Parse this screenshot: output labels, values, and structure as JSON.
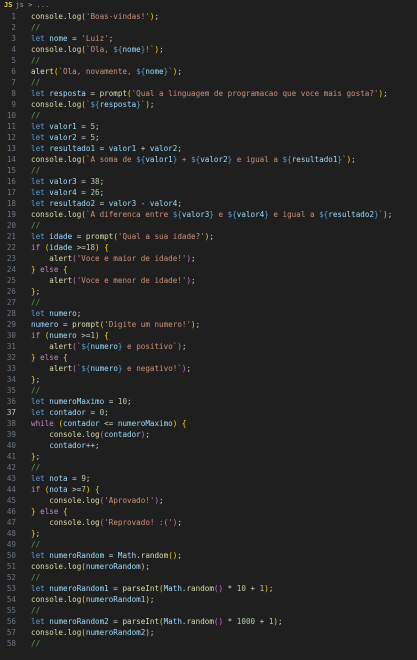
{
  "breadcrumb": {
    "file_badge": "JS",
    "file_name": "js",
    "chevron": ">",
    "trailing": "..."
  },
  "active_line": 37,
  "code_lines": [
    [
      [
        "fn",
        "console.log"
      ],
      [
        "br1",
        "("
      ],
      [
        "str",
        "'Boas-vindas!'"
      ],
      [
        "br1",
        ")"
      ],
      [
        "p",
        ";"
      ]
    ],
    [
      [
        "cm",
        "//"
      ]
    ],
    [
      [
        "kw",
        "let "
      ],
      [
        "var",
        "nome"
      ],
      [
        "p",
        " = "
      ],
      [
        "str",
        "'Luiz'"
      ],
      [
        "p",
        ";"
      ]
    ],
    [
      [
        "fn",
        "console.log"
      ],
      [
        "br1",
        "("
      ],
      [
        "str",
        "`Ola, "
      ],
      [
        "tp",
        "${"
      ],
      [
        "var",
        "nome"
      ],
      [
        "tp",
        "}"
      ],
      [
        "str",
        "!`"
      ],
      [
        "br1",
        ")"
      ],
      [
        "p",
        ";"
      ]
    ],
    [
      [
        "cm",
        "//"
      ]
    ],
    [
      [
        "fn",
        "alert"
      ],
      [
        "br1",
        "("
      ],
      [
        "str",
        "`Ola, novamente, "
      ],
      [
        "tp",
        "${"
      ],
      [
        "var",
        "nome"
      ],
      [
        "tp",
        "}"
      ],
      [
        "str",
        "`"
      ],
      [
        "br1",
        ")"
      ],
      [
        "p",
        ";"
      ]
    ],
    [
      [
        "cm",
        "//"
      ]
    ],
    [
      [
        "kw",
        "let "
      ],
      [
        "var",
        "resposta"
      ],
      [
        "p",
        " = "
      ],
      [
        "fn",
        "prompt"
      ],
      [
        "br1",
        "("
      ],
      [
        "str",
        "'Qual a linguagem de programacao que voce mais gosta?'"
      ],
      [
        "br1",
        ")"
      ],
      [
        "p",
        ";"
      ]
    ],
    [
      [
        "fn",
        "console.log"
      ],
      [
        "br1",
        "("
      ],
      [
        "str",
        "`"
      ],
      [
        "tp",
        "${"
      ],
      [
        "var",
        "resposta"
      ],
      [
        "tp",
        "}"
      ],
      [
        "str",
        "`"
      ],
      [
        "br1",
        ")"
      ],
      [
        "p",
        ";"
      ]
    ],
    [
      [
        "cm",
        "//"
      ]
    ],
    [
      [
        "kw",
        "let "
      ],
      [
        "var",
        "valor1"
      ],
      [
        "p",
        " = "
      ],
      [
        "num",
        "5"
      ],
      [
        "p",
        ";"
      ]
    ],
    [
      [
        "kw",
        "let "
      ],
      [
        "var",
        "valor2"
      ],
      [
        "p",
        " = "
      ],
      [
        "num",
        "5"
      ],
      [
        "p",
        ";"
      ]
    ],
    [
      [
        "kw",
        "let "
      ],
      [
        "var",
        "resultado1"
      ],
      [
        "p",
        " = "
      ],
      [
        "var",
        "valor1"
      ],
      [
        "p",
        " + "
      ],
      [
        "var",
        "valor2"
      ],
      [
        "p",
        ";"
      ]
    ],
    [
      [
        "fn",
        "console.log"
      ],
      [
        "br1",
        "("
      ],
      [
        "str",
        "`A soma de "
      ],
      [
        "tp",
        "${"
      ],
      [
        "var",
        "valor1"
      ],
      [
        "tp",
        "}"
      ],
      [
        "str",
        " + "
      ],
      [
        "tp",
        "${"
      ],
      [
        "var",
        "valor2"
      ],
      [
        "tp",
        "}"
      ],
      [
        "str",
        " e igual a "
      ],
      [
        "tp",
        "${"
      ],
      [
        "var",
        "resultado1"
      ],
      [
        "tp",
        "}"
      ],
      [
        "str",
        "`"
      ],
      [
        "br1",
        ")"
      ],
      [
        "p",
        ";"
      ]
    ],
    [
      [
        "cm",
        "//"
      ]
    ],
    [
      [
        "kw",
        "let "
      ],
      [
        "var",
        "valor3"
      ],
      [
        "p",
        " = "
      ],
      [
        "num",
        "38"
      ],
      [
        "p",
        ";"
      ]
    ],
    [
      [
        "kw",
        "let "
      ],
      [
        "var",
        "valor4"
      ],
      [
        "p",
        " = "
      ],
      [
        "num",
        "26"
      ],
      [
        "p",
        ";"
      ]
    ],
    [
      [
        "kw",
        "let "
      ],
      [
        "var",
        "resultado2"
      ],
      [
        "p",
        " = "
      ],
      [
        "var",
        "valor3"
      ],
      [
        "p",
        " - "
      ],
      [
        "var",
        "valor4"
      ],
      [
        "p",
        ";"
      ]
    ],
    [
      [
        "fn",
        "console.log"
      ],
      [
        "br1",
        "("
      ],
      [
        "str",
        "`A diferenca entre "
      ],
      [
        "tp",
        "${"
      ],
      [
        "var",
        "valor3"
      ],
      [
        "tp",
        "}"
      ],
      [
        "str",
        " e "
      ],
      [
        "tp",
        "${"
      ],
      [
        "var",
        "valor4"
      ],
      [
        "tp",
        "}"
      ],
      [
        "str",
        " e igual a "
      ],
      [
        "tp",
        "${"
      ],
      [
        "var",
        "resultado2"
      ],
      [
        "tp",
        "}"
      ],
      [
        "str",
        "`"
      ],
      [
        "br1",
        ")"
      ],
      [
        "p",
        ";"
      ]
    ],
    [
      [
        "cm",
        "//"
      ]
    ],
    [
      [
        "kw",
        "let "
      ],
      [
        "var",
        "idade"
      ],
      [
        "p",
        " = "
      ],
      [
        "fn",
        "prompt"
      ],
      [
        "br1",
        "("
      ],
      [
        "str",
        "'Qual a sua idade?'"
      ],
      [
        "br1",
        ")"
      ],
      [
        "p",
        ";"
      ]
    ],
    [
      [
        "ctl",
        "if "
      ],
      [
        "br1",
        "("
      ],
      [
        "var",
        "idade"
      ],
      [
        "p",
        " >="
      ],
      [
        "num",
        "18"
      ],
      [
        "br1",
        ")"
      ],
      [
        "p",
        " "
      ],
      [
        "br1",
        "{"
      ]
    ],
    [
      [
        "p",
        "    "
      ],
      [
        "fn",
        "alert"
      ],
      [
        "br2",
        "("
      ],
      [
        "str",
        "'Voce e maior de idade!'"
      ],
      [
        "br2",
        ")"
      ],
      [
        "p",
        ";"
      ]
    ],
    [
      [
        "br1",
        "}"
      ],
      [
        "p",
        " "
      ],
      [
        "ctl",
        "else "
      ],
      [
        "br1",
        "{"
      ]
    ],
    [
      [
        "p",
        "    "
      ],
      [
        "fn",
        "alert"
      ],
      [
        "br2",
        "("
      ],
      [
        "str",
        "'Voce e menor de idade!'"
      ],
      [
        "br2",
        ")"
      ],
      [
        "p",
        ";"
      ]
    ],
    [
      [
        "br1",
        "}"
      ],
      [
        "p",
        ";"
      ]
    ],
    [
      [
        "cm",
        "//"
      ]
    ],
    [
      [
        "kw",
        "let "
      ],
      [
        "var",
        "numero"
      ],
      [
        "p",
        ";"
      ]
    ],
    [
      [
        "var",
        "numero"
      ],
      [
        "p",
        " = "
      ],
      [
        "fn",
        "prompt"
      ],
      [
        "br1",
        "("
      ],
      [
        "str",
        "'Digite um numero!'"
      ],
      [
        "br1",
        ")"
      ],
      [
        "p",
        ";"
      ]
    ],
    [
      [
        "ctl",
        "if "
      ],
      [
        "br1",
        "("
      ],
      [
        "var",
        "numero"
      ],
      [
        "p",
        " >="
      ],
      [
        "num",
        "1"
      ],
      [
        "br1",
        ")"
      ],
      [
        "p",
        " "
      ],
      [
        "br1",
        "{"
      ]
    ],
    [
      [
        "p",
        "    "
      ],
      [
        "fn",
        "alert"
      ],
      [
        "br2",
        "("
      ],
      [
        "str",
        "`"
      ],
      [
        "tp",
        "${"
      ],
      [
        "var",
        "numero"
      ],
      [
        "tp",
        "}"
      ],
      [
        "str",
        " e positivo`"
      ],
      [
        "br2",
        ")"
      ],
      [
        "p",
        ";"
      ]
    ],
    [
      [
        "br1",
        "}"
      ],
      [
        "p",
        " "
      ],
      [
        "ctl",
        "else "
      ],
      [
        "br1",
        "{"
      ]
    ],
    [
      [
        "p",
        "    "
      ],
      [
        "fn",
        "alert"
      ],
      [
        "br2",
        "("
      ],
      [
        "str",
        "`"
      ],
      [
        "tp",
        "${"
      ],
      [
        "var",
        "numero"
      ],
      [
        "tp",
        "}"
      ],
      [
        "str",
        " e negativo!`"
      ],
      [
        "br2",
        ")"
      ],
      [
        "p",
        ";"
      ]
    ],
    [
      [
        "br1",
        "}"
      ],
      [
        "p",
        ";"
      ]
    ],
    [
      [
        "cm",
        "//"
      ]
    ],
    [
      [
        "kw",
        "let "
      ],
      [
        "var",
        "numeroMaximo"
      ],
      [
        "p",
        " = "
      ],
      [
        "num",
        "10"
      ],
      [
        "p",
        ";"
      ]
    ],
    [
      [
        "kw",
        "let "
      ],
      [
        "var",
        "contador"
      ],
      [
        "p",
        " = "
      ],
      [
        "num",
        "0"
      ],
      [
        "p",
        ";"
      ]
    ],
    [
      [
        "ctl",
        "while "
      ],
      [
        "br1",
        "("
      ],
      [
        "var",
        "contador"
      ],
      [
        "p",
        " <= "
      ],
      [
        "var",
        "numeroMaximo"
      ],
      [
        "br1",
        ")"
      ],
      [
        "p",
        " "
      ],
      [
        "br1",
        "{"
      ]
    ],
    [
      [
        "p",
        "    "
      ],
      [
        "fn",
        "console.log"
      ],
      [
        "br2",
        "("
      ],
      [
        "var",
        "contador"
      ],
      [
        "br2",
        ")"
      ],
      [
        "p",
        ";"
      ]
    ],
    [
      [
        "p",
        "    "
      ],
      [
        "var",
        "contador"
      ],
      [
        "p",
        "++;"
      ]
    ],
    [
      [
        "br1",
        "}"
      ],
      [
        "p",
        ";"
      ]
    ],
    [
      [
        "cm",
        "//"
      ]
    ],
    [
      [
        "kw",
        "let "
      ],
      [
        "var",
        "nota"
      ],
      [
        "p",
        " = "
      ],
      [
        "num",
        "9"
      ],
      [
        "p",
        ";"
      ]
    ],
    [
      [
        "ctl",
        "if "
      ],
      [
        "br1",
        "("
      ],
      [
        "var",
        "nota"
      ],
      [
        "p",
        " >="
      ],
      [
        "num",
        "7"
      ],
      [
        "br1",
        ")"
      ],
      [
        "p",
        " "
      ],
      [
        "br1",
        "{"
      ]
    ],
    [
      [
        "p",
        "    "
      ],
      [
        "fn",
        "console.log"
      ],
      [
        "br2",
        "("
      ],
      [
        "str",
        "'Aprovado!'"
      ],
      [
        "br2",
        ")"
      ],
      [
        "p",
        ";"
      ]
    ],
    [
      [
        "br1",
        "}"
      ],
      [
        "p",
        " "
      ],
      [
        "ctl",
        "else "
      ],
      [
        "br1",
        "{"
      ]
    ],
    [
      [
        "p",
        "    "
      ],
      [
        "fn",
        "console.log"
      ],
      [
        "br2",
        "("
      ],
      [
        "str",
        "'Reprovado! :('"
      ],
      [
        "br2",
        ")"
      ],
      [
        "p",
        ";"
      ]
    ],
    [
      [
        "br1",
        "}"
      ],
      [
        "p",
        ";"
      ]
    ],
    [
      [
        "cm",
        "//"
      ]
    ],
    [
      [
        "kw",
        "let "
      ],
      [
        "var",
        "numeroRandom"
      ],
      [
        "p",
        " = "
      ],
      [
        "var",
        "Math"
      ],
      [
        "p",
        "."
      ],
      [
        "fn",
        "random"
      ],
      [
        "br1",
        "()"
      ],
      [
        "p",
        ";"
      ]
    ],
    [
      [
        "fn",
        "console.log"
      ],
      [
        "br1",
        "("
      ],
      [
        "var",
        "numeroRandom"
      ],
      [
        "br1",
        ")"
      ],
      [
        "p",
        ";"
      ]
    ],
    [
      [
        "cm",
        "//"
      ]
    ],
    [
      [
        "kw",
        "let "
      ],
      [
        "var",
        "numeroRandom1"
      ],
      [
        "p",
        " = "
      ],
      [
        "fn",
        "parseInt"
      ],
      [
        "br1",
        "("
      ],
      [
        "var",
        "Math"
      ],
      [
        "p",
        "."
      ],
      [
        "fn",
        "random"
      ],
      [
        "br2",
        "()"
      ],
      [
        "p",
        " * "
      ],
      [
        "num",
        "10"
      ],
      [
        "p",
        " + "
      ],
      [
        "num",
        "1"
      ],
      [
        "br1",
        ")"
      ],
      [
        "p",
        ";"
      ]
    ],
    [
      [
        "fn",
        "console.log"
      ],
      [
        "br1",
        "("
      ],
      [
        "var",
        "numeroRandom1"
      ],
      [
        "br1",
        ")"
      ],
      [
        "p",
        ";"
      ]
    ],
    [
      [
        "cm",
        "//"
      ]
    ],
    [
      [
        "kw",
        "let "
      ],
      [
        "var",
        "numeroRandom2"
      ],
      [
        "p",
        " = "
      ],
      [
        "fn",
        "parseInt"
      ],
      [
        "br1",
        "("
      ],
      [
        "var",
        "Math"
      ],
      [
        "p",
        "."
      ],
      [
        "fn",
        "random"
      ],
      [
        "br2",
        "()"
      ],
      [
        "p",
        " * "
      ],
      [
        "num",
        "1000"
      ],
      [
        "p",
        " + "
      ],
      [
        "num",
        "1"
      ],
      [
        "br1",
        ")"
      ],
      [
        "p",
        ";"
      ]
    ],
    [
      [
        "fn",
        "console.log"
      ],
      [
        "br1",
        "("
      ],
      [
        "var",
        "numeroRandom2"
      ],
      [
        "br1",
        ")"
      ],
      [
        "p",
        ";"
      ]
    ],
    [
      [
        "cm",
        "//"
      ]
    ]
  ]
}
